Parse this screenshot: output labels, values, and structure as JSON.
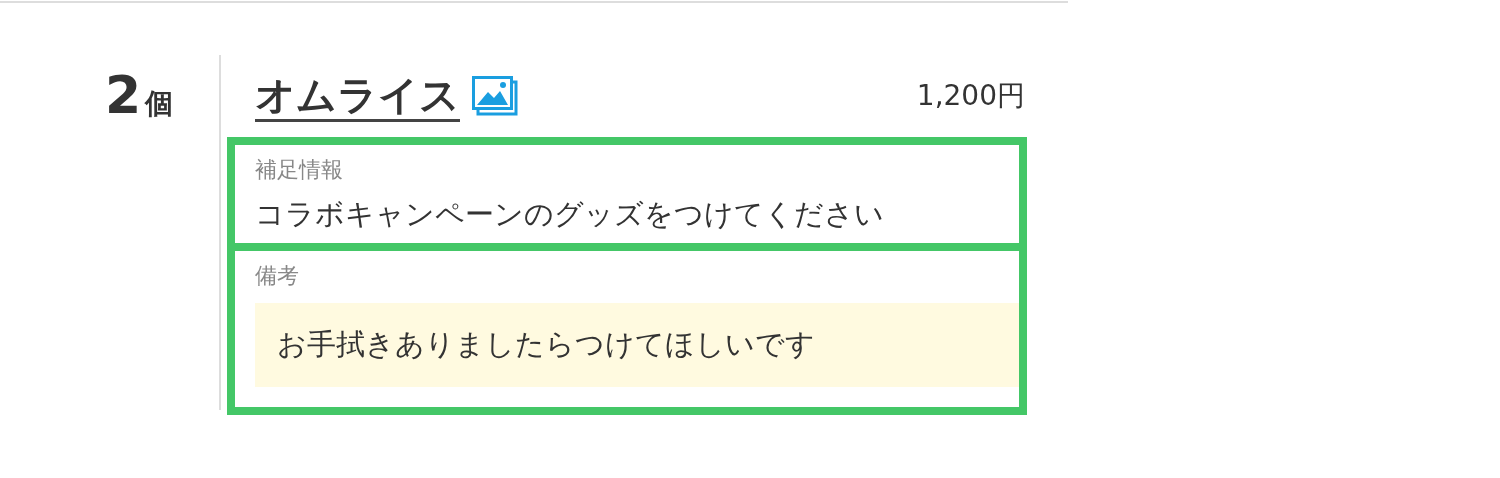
{
  "quantity": {
    "number": "2",
    "unit": "個"
  },
  "item": {
    "name": "オムライス",
    "price": "1,200円"
  },
  "sections": [
    {
      "kind": "plain",
      "label": "補足情報",
      "value": "コラボキャンペーンのグッズをつけてください",
      "highlighted": true
    },
    {
      "kind": "note",
      "label": "備考",
      "value": "お手拭きありましたらつけてほしいです",
      "highlighted": true
    }
  ]
}
